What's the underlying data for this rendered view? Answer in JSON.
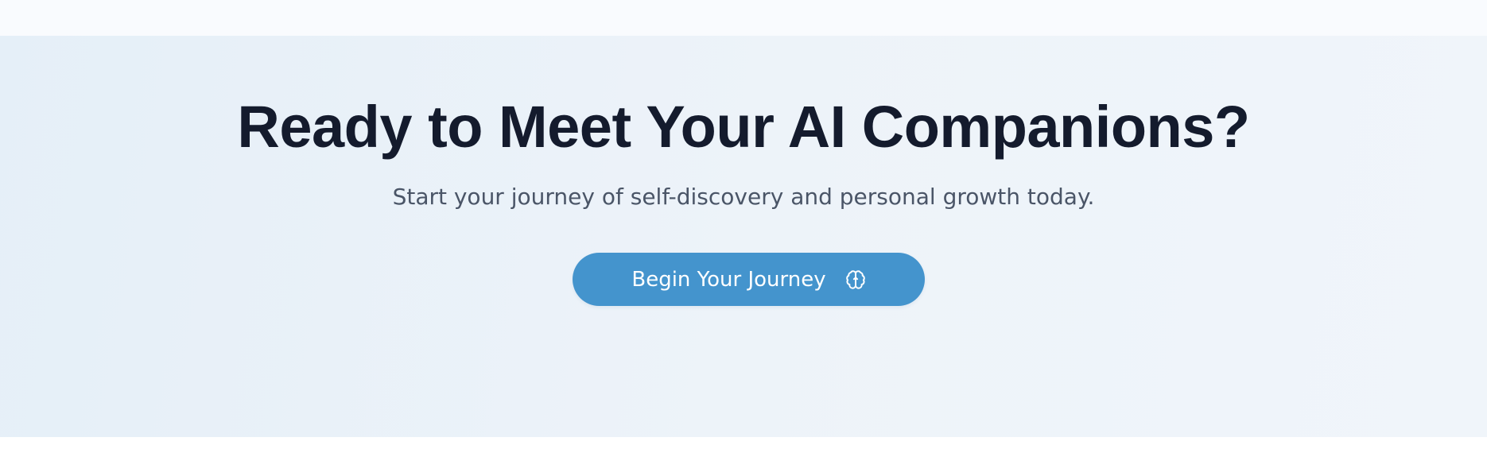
{
  "cta": {
    "title": "Ready to Meet Your AI Companions?",
    "subtitle": "Start your journey of self-discovery and personal growth today.",
    "button_label": "Begin Your Journey",
    "button_icon": "brain-icon",
    "accent_color": "#4494cd",
    "title_color": "#141b2d",
    "subtitle_color": "#4a5567"
  }
}
